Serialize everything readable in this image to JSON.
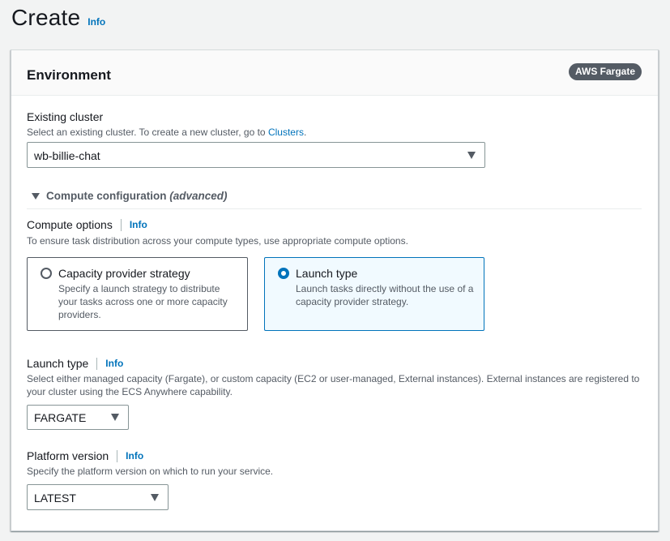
{
  "page": {
    "title": "Create",
    "info": "Info"
  },
  "environment": {
    "title": "Environment",
    "badge": "AWS Fargate",
    "existing_cluster": {
      "label": "Existing cluster",
      "description": "Select an existing cluster. To create a new cluster, go to",
      "link": "Clusters",
      "link_suffix": ".",
      "value": "wb-billie-chat"
    },
    "compute_config": {
      "label": "Compute configuration",
      "qualifier": "(advanced)"
    },
    "compute_options": {
      "label": "Compute options",
      "info": "Info",
      "description": "To ensure task distribution across your compute types, use appropriate compute options.",
      "tiles": [
        {
          "title": "Capacity provider strategy",
          "description": "Specify a launch strategy to distribute your tasks across one or more capacity providers.",
          "selected": false
        },
        {
          "title": "Launch type",
          "description": "Launch tasks directly without the use of a capacity provider strategy.",
          "selected": true
        }
      ]
    },
    "launch_type": {
      "label": "Launch type",
      "info": "Info",
      "description": "Select either managed capacity (Fargate), or custom capacity (EC2 or user-managed, External instances). External instances are registered to your cluster using the ECS Anywhere capability.",
      "value": "FARGATE"
    },
    "platform_version": {
      "label": "Platform version",
      "info": "Info",
      "description": "Specify the platform version on which to run your service.",
      "value": "LATEST"
    }
  },
  "colors": {
    "link": "#0073bb",
    "badge_bg": "#545b64",
    "selected_tile_bg": "#f1faff"
  }
}
